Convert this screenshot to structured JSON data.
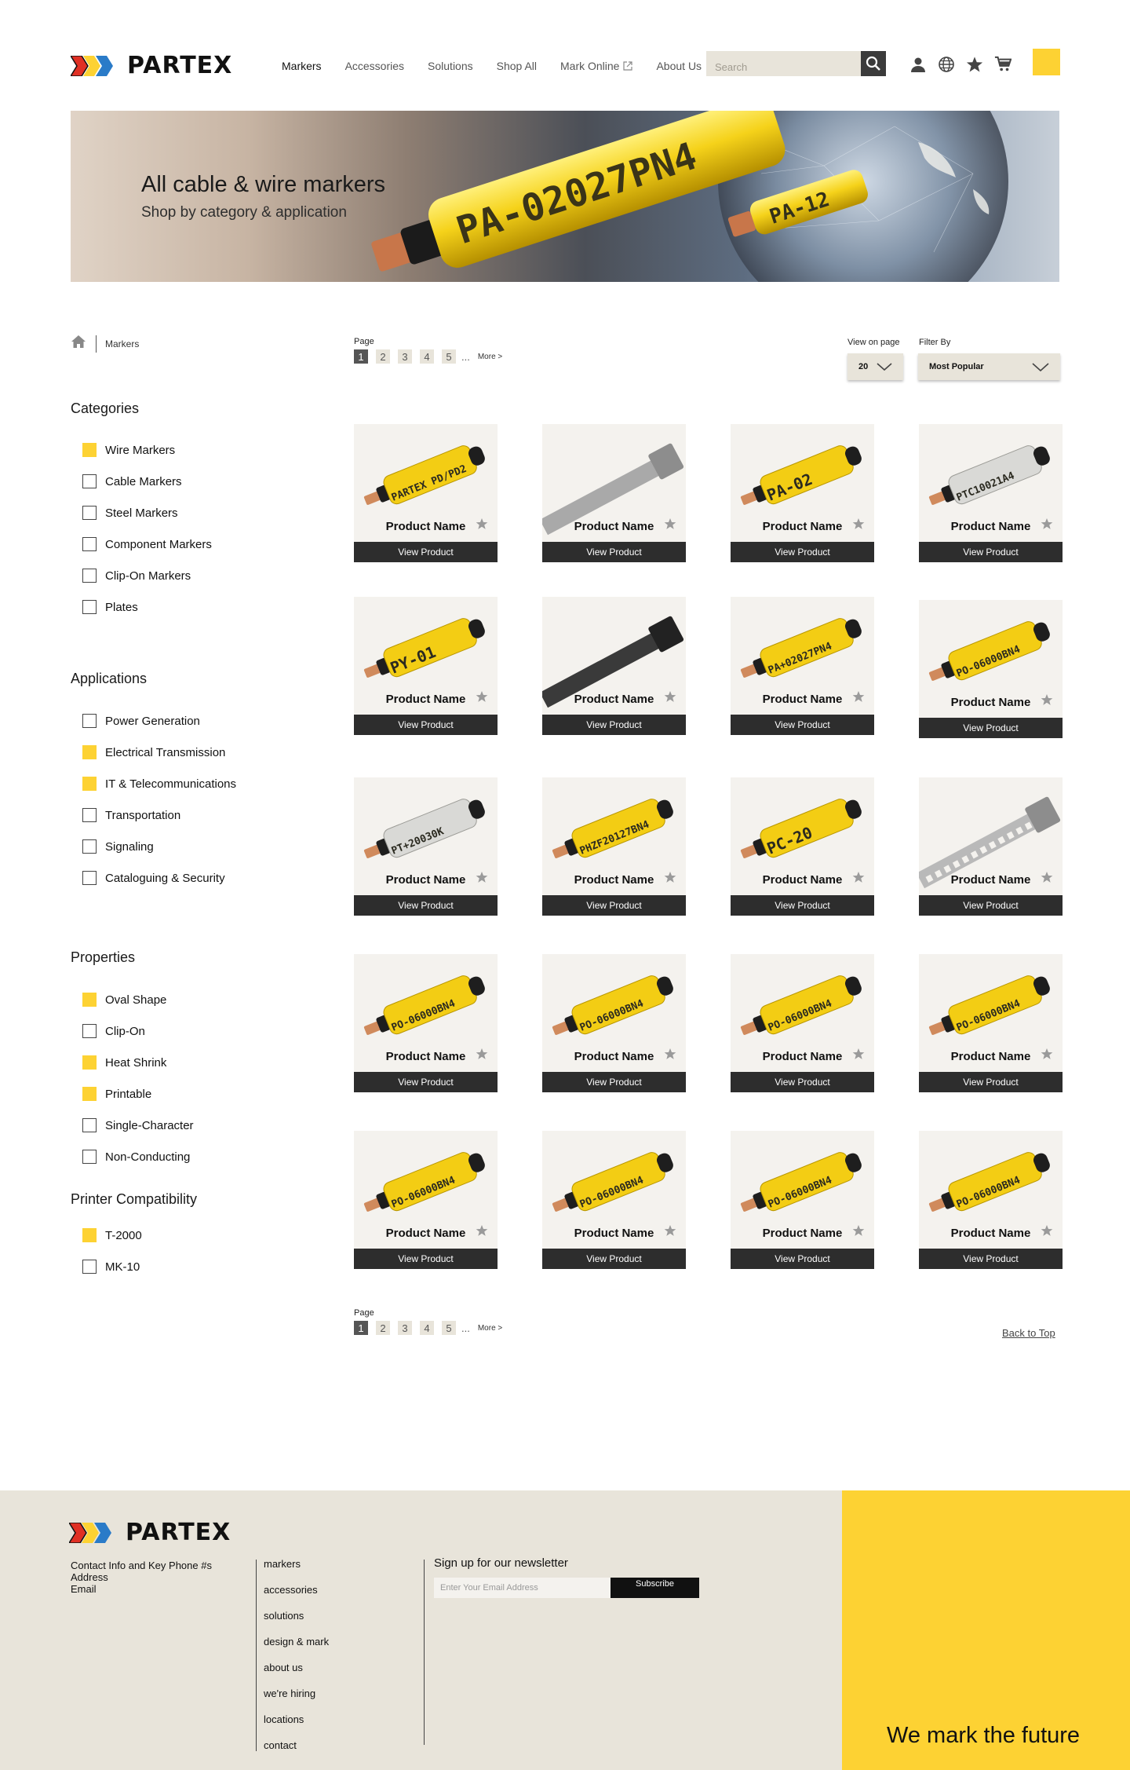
{
  "brand": {
    "name": "PARTEX",
    "accent": "#fdd233",
    "dark": "#2d2d2d"
  },
  "nav": {
    "items": [
      {
        "label": "Markers",
        "active": true
      },
      {
        "label": "Accessories"
      },
      {
        "label": "Solutions"
      },
      {
        "label": "Shop All"
      },
      {
        "label": "Mark Online",
        "external": true
      },
      {
        "label": "About Us"
      }
    ]
  },
  "search": {
    "placeholder": "Search"
  },
  "hero": {
    "title": "All cable & wire markers",
    "subtitle": "Shop by category & application",
    "marker_texts": [
      "PA-02027PN4",
      "PA-12"
    ]
  },
  "breadcrumb": {
    "current": "Markers"
  },
  "filters": {
    "categories": {
      "title": "Categories",
      "items": [
        {
          "label": "Wire Markers",
          "checked": true
        },
        {
          "label": "Cable Markers",
          "checked": false
        },
        {
          "label": "Steel Markers",
          "checked": false
        },
        {
          "label": "Component Markers",
          "checked": false
        },
        {
          "label": "Clip-On Markers",
          "checked": false
        },
        {
          "label": "Plates",
          "checked": false
        }
      ]
    },
    "applications": {
      "title": "Applications",
      "items": [
        {
          "label": "Power Generation",
          "checked": false
        },
        {
          "label": "Electrical Transmission",
          "checked": true
        },
        {
          "label": "IT & Telecommunications",
          "checked": true
        },
        {
          "label": "Transportation",
          "checked": false
        },
        {
          "label": "Signaling",
          "checked": false
        },
        {
          "label": "Cataloguing & Security",
          "checked": false
        }
      ]
    },
    "properties": {
      "title": "Properties",
      "items": [
        {
          "label": "Oval Shape",
          "checked": true
        },
        {
          "label": "Clip-On",
          "checked": false
        },
        {
          "label": "Heat Shrink",
          "checked": true
        },
        {
          "label": "Printable",
          "checked": true
        },
        {
          "label": "Single-Character",
          "checked": false
        },
        {
          "label": "Non-Conducting",
          "checked": false
        }
      ]
    },
    "printer": {
      "title": "Printer Compatibility",
      "items": [
        {
          "label": "T-2000",
          "checked": true
        },
        {
          "label": "MK-10",
          "checked": false
        }
      ]
    }
  },
  "pagination": {
    "label": "Page",
    "pages": [
      "1",
      "2",
      "3",
      "4",
      "5"
    ],
    "current": "1",
    "ellipsis": "...",
    "more": "More >"
  },
  "view_on_page": {
    "label": "View on page",
    "value": "20"
  },
  "filter_by": {
    "label": "Filter By",
    "value": "Most Popular"
  },
  "products": {
    "button_label": "View Product",
    "items": [
      {
        "name": "Product Name",
        "marker": "PARTEX PD/PD2",
        "kind": "marker"
      },
      {
        "name": "Product Name",
        "kind": "tie-steel"
      },
      {
        "name": "Product Name",
        "marker": "PA-02",
        "kind": "marker"
      },
      {
        "name": "Product Name",
        "marker": "PTC10021A4",
        "kind": "marker-clear"
      },
      {
        "name": "Product Name",
        "marker": "PY-01",
        "kind": "marker"
      },
      {
        "name": "Product Name",
        "kind": "tie-black"
      },
      {
        "name": "Product Name",
        "marker": "PA+02027PN4",
        "kind": "marker"
      },
      {
        "name": "Product Name",
        "marker": "PO-06000BN4",
        "kind": "marker"
      },
      {
        "name": "Product Name",
        "marker": "PT+20030K",
        "kind": "marker-clear"
      },
      {
        "name": "Product Name",
        "marker": "PHZF20127BN4",
        "kind": "marker"
      },
      {
        "name": "Product Name",
        "marker": "PC-20",
        "kind": "marker"
      },
      {
        "name": "Product Name",
        "kind": "tie-strip"
      },
      {
        "name": "Product Name",
        "marker": "PO-06000BN4",
        "kind": "marker"
      },
      {
        "name": "Product Name",
        "marker": "PO-06000BN4",
        "kind": "marker"
      },
      {
        "name": "Product Name",
        "marker": "PO-06000BN4",
        "kind": "marker"
      },
      {
        "name": "Product Name",
        "marker": "PO-06000BN4",
        "kind": "marker"
      },
      {
        "name": "Product Name",
        "marker": "PO-06000BN4",
        "kind": "marker"
      },
      {
        "name": "Product Name",
        "marker": "PO-06000BN4",
        "kind": "marker"
      },
      {
        "name": "Product Name",
        "marker": "PO-06000BN4",
        "kind": "marker"
      },
      {
        "name": "Product Name",
        "marker": "PO-06000BN4",
        "kind": "marker"
      }
    ]
  },
  "back_to_top": "Back to Top",
  "footer": {
    "contact": [
      "Contact Info and Key Phone #s",
      "Address",
      "Email"
    ],
    "links": [
      "markers",
      "accessories",
      "solutions",
      "design & mark",
      "about us",
      "we're hiring",
      "locations",
      "contact"
    ],
    "newsletter": {
      "title": "Sign up for our newsletter",
      "placeholder": "Enter Your Email Address",
      "button": "Subscribe"
    },
    "tagline": "We mark the future"
  }
}
